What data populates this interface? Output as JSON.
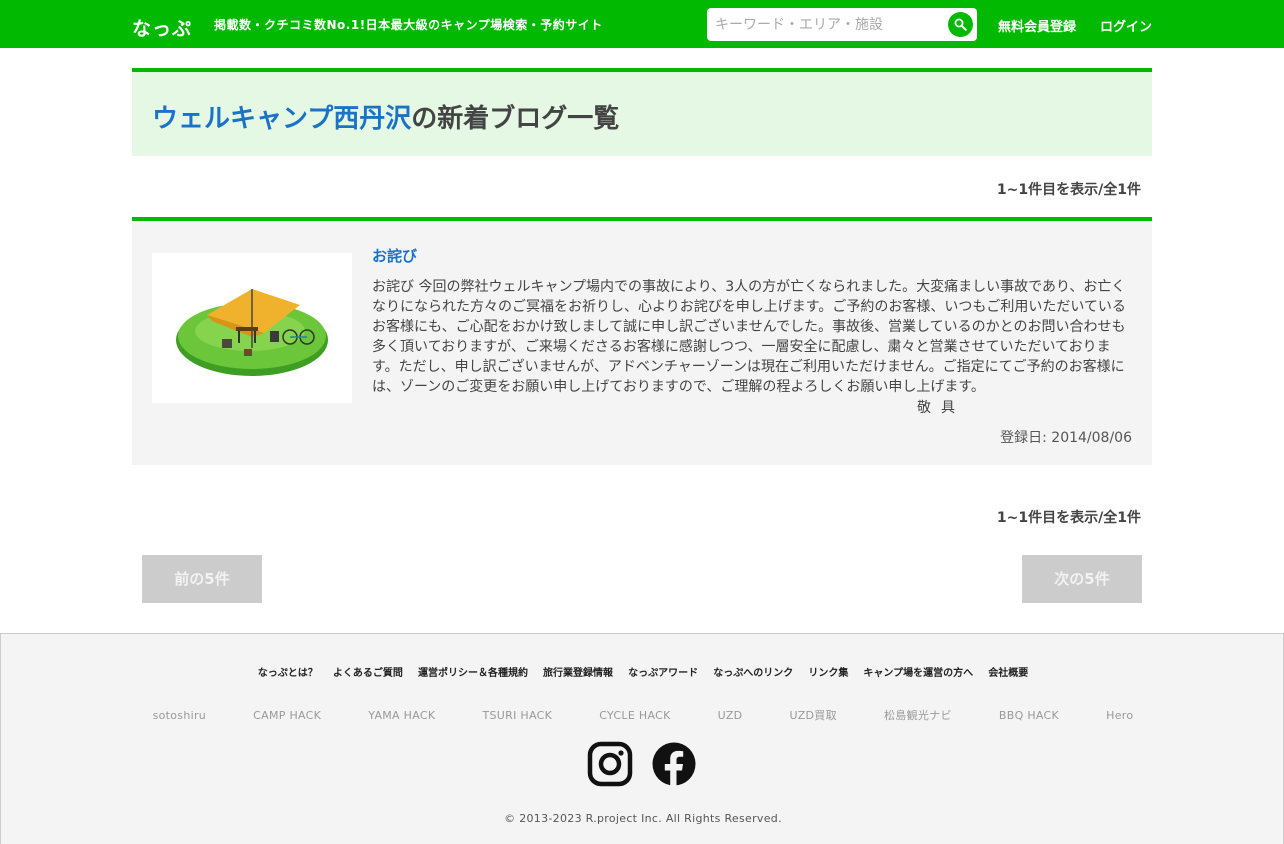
{
  "header": {
    "logo": "なっぷ",
    "tagline": "掲載数・クチコミ数No.1!日本最大級のキャンプ場検索・予約サイト",
    "search_placeholder": "キーワード・エリア・施設",
    "register_label": "無料会員登録",
    "login_label": "ログイン"
  },
  "page": {
    "title_campsite": "ウェルキャンプ西丹沢",
    "title_suffix": "の新着ブログ一覧",
    "count_top": "1~1件目を表示/全1件",
    "count_bottom": "1~1件目を表示/全1件"
  },
  "blog": {
    "title": "お詫び",
    "body": "お詫び 今回の弊社ウェルキャンプ場内での事故により、3人の方が亡くなられました。大変痛ましい事故であり、お亡くなりになられた方々のご冥福をお祈りし、心よりお詫びを申し上げます。ご予約のお客様、いつもご利用いただいているお客様にも、ご心配をおかけ致しまして誠に申し訳ございませんでした。事故後、営業しているのかとのお問い合わせも多く頂いておりますが、ご来場くださるお客様に感謝しつつ、一層安全に配慮し、粛々と営業させていただいております。ただし、申し訳ございませんが、アドベンチャーゾーンは現在ご利用いただけません。ご指定にてご予約のお客様には、ゾーンのご変更をお願い申し上げておりますので、ご理解の程よろしくお願い申し上げます。",
    "sign": "敬具",
    "date": "登録日: 2014/08/06"
  },
  "pagination": {
    "prev_label": "前の5件",
    "next_label": "次の5件"
  },
  "footer": {
    "nav": [
      "なっぷとは？",
      "よくあるご質問",
      "運営ポリシー＆各種規約",
      "旅行業登録情報",
      "なっぷアワード",
      "なっぷへのリンク",
      "リンク集",
      "キャンプ場を運営の方へ",
      "会社概要"
    ],
    "partners": [
      "sotoshiru",
      "CAMP HACK",
      "YAMA HACK",
      "TSURI HACK",
      "CYCLE HACK",
      "UZD",
      "UZD買取",
      "松島観光ナビ",
      "BBQ HACK",
      "Hero"
    ],
    "copyright": "© 2013-2023 R.project Inc. All Rights Reserved."
  },
  "colors": {
    "brand_green": "#00b900",
    "link_blue": "#1a73c8",
    "title_bg": "#e5f8e4"
  },
  "icons": {
    "search": "search-icon",
    "instagram": "instagram-icon",
    "facebook": "facebook-icon"
  }
}
